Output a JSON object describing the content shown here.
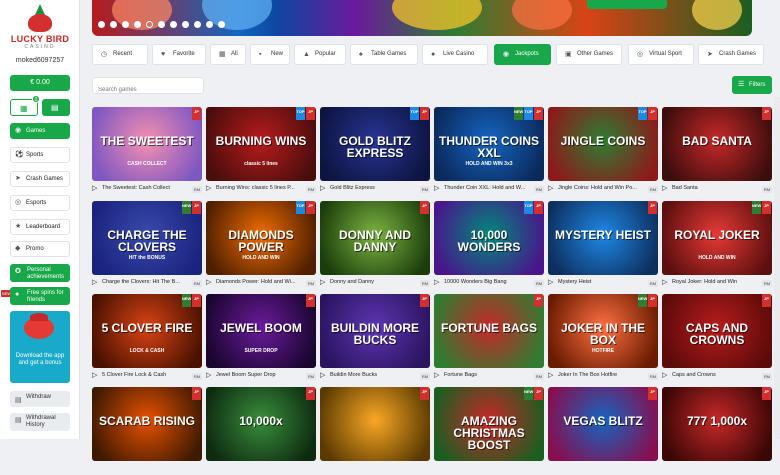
{
  "brand": {
    "name": "LUCKY BIRD",
    "sub": "CASINO"
  },
  "user": {
    "username": "moked6097257",
    "balance": "€ 0.00",
    "gift_badge": "0"
  },
  "sidebar": {
    "items": [
      {
        "label": "Games",
        "icon": "gamepad-icon"
      },
      {
        "label": "Sports",
        "icon": "soccer-ball-icon"
      },
      {
        "label": "Crash Games",
        "icon": "rocket-icon"
      },
      {
        "label": "Esports",
        "icon": "controller-icon"
      },
      {
        "label": "Leaderboard",
        "icon": "trophy-icon"
      },
      {
        "label": "Promo",
        "icon": "diamond-icon"
      },
      {
        "label": "Personal achievements",
        "icon": "medal-icon"
      },
      {
        "label": "Free spins for friends",
        "icon": "users-icon"
      }
    ],
    "new_tag": "NEW",
    "app_banner": "Download the app and get a bonus",
    "withdraw": "Withdraw",
    "withdrawal_history": "Withdrawal History"
  },
  "tabs": [
    {
      "label": "Recent",
      "icon": "clock-icon"
    },
    {
      "label": "Favorite",
      "icon": "heart-icon"
    },
    {
      "label": "All",
      "icon": "grid-icon"
    },
    {
      "label": "New",
      "icon": "new-icon"
    },
    {
      "label": "Popular",
      "icon": "fire-icon"
    },
    {
      "label": "Table Games",
      "icon": "cards-icon"
    },
    {
      "label": "Live Casino",
      "icon": "live-icon"
    },
    {
      "label": "Jackpots",
      "icon": "jackpot-icon"
    },
    {
      "label": "Other Games",
      "icon": "dice-icon"
    },
    {
      "label": "Virtual Sport",
      "icon": "virtual-icon"
    },
    {
      "label": "Crash Games",
      "icon": "rocket-icon"
    }
  ],
  "search": {
    "placeholder": "Search games"
  },
  "filters": {
    "label": "Filters"
  },
  "games": [
    {
      "name": "The Sweetest: Cash Collect",
      "art": "THE SWEETEST",
      "sub": "CASH COLLECT",
      "badge": "RM",
      "ribbons": [
        "jp"
      ],
      "colors": [
        "#f48fb1",
        "#7e57c2"
      ]
    },
    {
      "name": "Burning Wins: classic 5 lines P...",
      "art": "BURNING WINS",
      "sub": "classic 5 lines",
      "badge": "RM",
      "ribbons": [
        "top",
        "jp"
      ],
      "colors": [
        "#b71c1c",
        "#4a0d0d"
      ]
    },
    {
      "name": "Gold Blitz Express",
      "art": "GOLD BLITZ EXPRESS",
      "sub": "",
      "badge": "RM",
      "ribbons": [
        "top",
        "jp"
      ],
      "colors": [
        "#283593",
        "#0d1440"
      ]
    },
    {
      "name": "Thunder Coin XXL: Hold and W...",
      "art": "THUNDER COINS XXL",
      "sub": "HOLD AND WIN 3x3",
      "badge": "RM",
      "ribbons": [
        "new",
        "top",
        "jp"
      ],
      "colors": [
        "#1565c0",
        "#0b2a5c"
      ]
    },
    {
      "name": "Jingle Coins: Hold and Win Po...",
      "art": "JINGLE COINS",
      "sub": "",
      "badge": "RM",
      "ribbons": [
        "top",
        "jp"
      ],
      "colors": [
        "#2e7d32",
        "#8d1a1a"
      ]
    },
    {
      "name": "Bad Santa",
      "art": "BAD SANTA",
      "sub": "",
      "badge": "RM",
      "ribbons": [
        "jp"
      ],
      "colors": [
        "#c62828",
        "#3b0d0d"
      ]
    },
    {
      "name": "Charge the Clovers: Hit The B...",
      "art": "CHARGE THE CLOVERS",
      "sub": "HIT the BONUS",
      "badge": "RM",
      "ribbons": [
        "new",
        "jp"
      ],
      "colors": [
        "#3949ab",
        "#1a237e"
      ]
    },
    {
      "name": "Diamonds Power: Hold and Wi...",
      "art": "DIAMONDS POWER",
      "sub": "HOLD AND WIN",
      "badge": "RM",
      "ribbons": [
        "top",
        "jp"
      ],
      "colors": [
        "#ef6c00",
        "#4e1f00"
      ]
    },
    {
      "name": "Donny and Danny",
      "art": "DONNY AND DANNY",
      "sub": "",
      "badge": "RM",
      "ribbons": [
        "jp"
      ],
      "colors": [
        "#7cb342",
        "#1b3d0a"
      ]
    },
    {
      "name": "10000 Wonders Big Bang",
      "art": "10,000 WONDERS",
      "sub": "",
      "badge": "RM",
      "ribbons": [
        "top",
        "jp"
      ],
      "colors": [
        "#00897b",
        "#4a148c"
      ]
    },
    {
      "name": "Mystery Heist",
      "art": "MYSTERY HEIST",
      "sub": "",
      "badge": "RM",
      "ribbons": [
        "jp"
      ],
      "colors": [
        "#1e88e5",
        "#0d2f5e"
      ]
    },
    {
      "name": "Royal Joker: Hold and Win",
      "art": "ROYAL JOKER",
      "sub": "HOLD AND WIN",
      "badge": "RM",
      "ribbons": [
        "new",
        "jp"
      ],
      "colors": [
        "#e53935",
        "#5c0f0f"
      ]
    },
    {
      "name": "5 Clover Fire Lock & Cash",
      "art": "5 CLOVER FIRE",
      "sub": "LOCK & CASH",
      "badge": "RM",
      "ribbons": [
        "new",
        "jp"
      ],
      "colors": [
        "#d84315",
        "#4a1100"
      ]
    },
    {
      "name": "Jewel Boom Super Drop",
      "art": "JEWEL BOOM",
      "sub": "SUPER DROP",
      "badge": "RM",
      "ribbons": [
        "jp"
      ],
      "colors": [
        "#6a1b9a",
        "#1a0530"
      ]
    },
    {
      "name": "Buildin More Bucks",
      "art": "BUILDIN MORE BUCKS",
      "sub": "",
      "badge": "RM",
      "ribbons": [
        "jp"
      ],
      "colors": [
        "#5e35b1",
        "#2a1460"
      ]
    },
    {
      "name": "Fortune Bags",
      "art": "FORTUNE BAGS",
      "sub": "",
      "badge": "RM",
      "ribbons": [
        "jp"
      ],
      "colors": [
        "#c62828",
        "#2e7d32"
      ]
    },
    {
      "name": "Joker In The Box Hotfire",
      "art": "JOKER IN THE BOX",
      "sub": "HOTFIRE",
      "badge": "RM",
      "ribbons": [
        "new",
        "jp"
      ],
      "colors": [
        "#ff7043",
        "#6a1b00"
      ]
    },
    {
      "name": "Caps and Crowns",
      "art": "CAPS AND CROWNS",
      "sub": "",
      "badge": "RM",
      "ribbons": [
        "jp"
      ],
      "colors": [
        "#b71c1c",
        "#5d0a0a"
      ]
    },
    {
      "name": "",
      "art": "SCARAB RISING",
      "sub": "",
      "badge": "",
      "ribbons": [
        "jp"
      ],
      "colors": [
        "#e65100",
        "#3e1a00"
      ]
    },
    {
      "name": "",
      "art": "10,000x",
      "sub": "",
      "badge": "",
      "ribbons": [
        "jp"
      ],
      "colors": [
        "#388e3c",
        "#0e2a10"
      ]
    },
    {
      "name": "",
      "art": "",
      "sub": "",
      "badge": "",
      "ribbons": [
        "jp"
      ],
      "colors": [
        "#f9a825",
        "#5a3a00"
      ]
    },
    {
      "name": "",
      "art": "AMAZING CHRISTMAS BOOST",
      "sub": "",
      "badge": "",
      "ribbons": [
        "new",
        "jp"
      ],
      "colors": [
        "#c62828",
        "#1b5e20"
      ]
    },
    {
      "name": "",
      "art": "VEGAS BLITZ",
      "sub": "",
      "badge": "",
      "ribbons": [
        "jp"
      ],
      "colors": [
        "#1565c0",
        "#880e4f"
      ]
    },
    {
      "name": "",
      "art": "777 1,000x",
      "sub": "",
      "badge": "",
      "ribbons": [
        "jp"
      ],
      "colors": [
        "#c62828",
        "#3a0606"
      ]
    }
  ],
  "colors": {
    "accent": "#18a84a",
    "jackpot_ribbon": "#d32f2f",
    "top_ribbon": "#1e88e5",
    "new_ribbon": "#2e7d32"
  }
}
